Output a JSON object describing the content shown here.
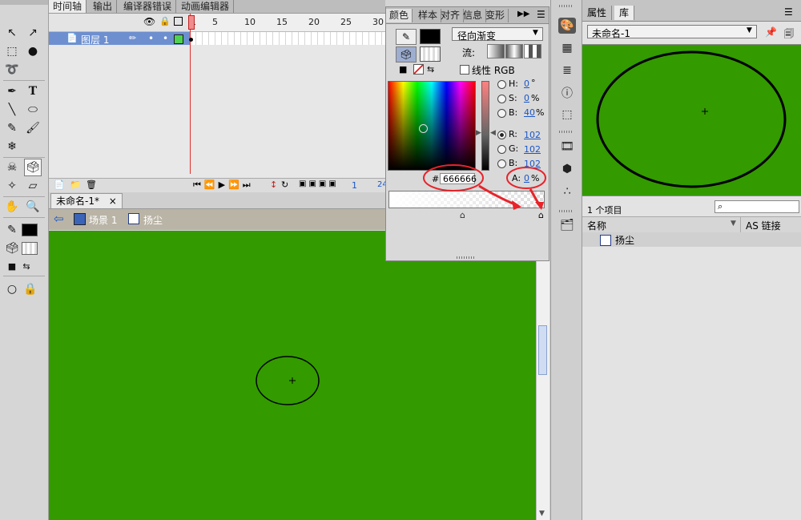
{
  "timeline": {
    "tabs": [
      "时间轴",
      "输出",
      "编译器错误",
      "动画编辑器"
    ],
    "layer_name": "图层 1",
    "ruler_numbers": [
      "1",
      "5",
      "10",
      "15",
      "20",
      "25",
      "30"
    ],
    "bottom_frame_num": "1",
    "bottom_fps": "24"
  },
  "document": {
    "tab_label": "未命名-1*",
    "close": "×",
    "scene_label": "场景 1",
    "symbol_label": "扬尘"
  },
  "color_panel": {
    "tabs": [
      "颜色",
      "样本",
      "对齐",
      "信息",
      "变形"
    ],
    "fill_type": "径向渐变",
    "flow_label": "流:",
    "linear_rgb_label": "线性 RGB",
    "hsb": [
      {
        "label": "H:",
        "value": "0",
        "unit": "°"
      },
      {
        "label": "S:",
        "value": "0",
        "unit": "%"
      },
      {
        "label": "B:",
        "value": "40",
        "unit": "%"
      }
    ],
    "rgb": [
      {
        "label": "R:",
        "value": "102"
      },
      {
        "label": "G:",
        "value": "102"
      },
      {
        "label": "B:",
        "value": "102"
      }
    ],
    "hex_label": "#",
    "hex_value": "666666",
    "alpha_label": "A:",
    "alpha_value": "0",
    "alpha_unit": "%"
  },
  "library": {
    "tabs": [
      "属性",
      "库"
    ],
    "document_name": "未命名-1",
    "item_count": "1 个项目",
    "col_name": "名称",
    "col_linkage": "AS 链接",
    "items": [
      "扬尘"
    ]
  },
  "colors": {
    "stage_green": "#339a00",
    "annotation_red": "#e8232a",
    "layer_blue": "#6d8fd0"
  }
}
